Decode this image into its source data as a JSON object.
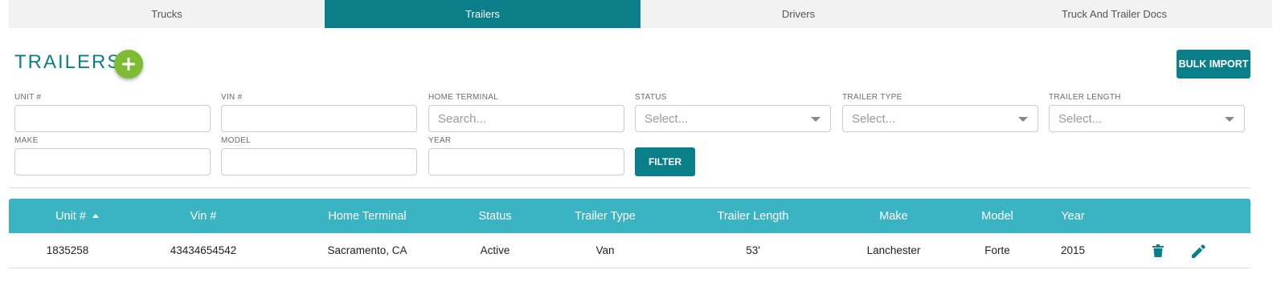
{
  "tabs": [
    {
      "label": "Trucks",
      "active": false
    },
    {
      "label": "Trailers",
      "active": true
    },
    {
      "label": "Drivers",
      "active": false
    },
    {
      "label": "Truck And Trailer Docs",
      "active": false
    }
  ],
  "header": {
    "title": "TRAILERS",
    "add_icon": "plus-icon",
    "bulk_import_label": "BULK IMPORT"
  },
  "filters": {
    "unit": {
      "label": "UNIT #",
      "value": "",
      "placeholder": ""
    },
    "vin": {
      "label": "VIN #",
      "value": "",
      "placeholder": ""
    },
    "home_terminal": {
      "label": "HOME TERMINAL",
      "value": "",
      "placeholder": "Search..."
    },
    "status": {
      "label": "STATUS",
      "selected": "Select..."
    },
    "trailer_type": {
      "label": "TRAILER TYPE",
      "selected": "Select..."
    },
    "trailer_length": {
      "label": "TRAILER LENGTH",
      "selected": "Select..."
    },
    "make": {
      "label": "MAKE",
      "value": "",
      "placeholder": ""
    },
    "model": {
      "label": "MODEL",
      "value": "",
      "placeholder": ""
    },
    "year": {
      "label": "YEAR",
      "value": "",
      "placeholder": ""
    },
    "filter_button_label": "FILTER"
  },
  "table": {
    "columns": [
      "Unit #",
      "Vin #",
      "Home Terminal",
      "Status",
      "Trailer Type",
      "Trailer Length",
      "Make",
      "Model",
      "Year"
    ],
    "sorted_column": "Unit #",
    "sort_direction": "asc",
    "rows": [
      {
        "unit": "1835258",
        "vin": "43434654542",
        "home_terminal": "Sacramento, CA",
        "status": "Active",
        "trailer_type": "Van",
        "trailer_length": "53'",
        "make": "Lanchester",
        "model": "Forte",
        "year": "2015",
        "actions": [
          "trash-icon",
          "pencil-icon"
        ]
      }
    ]
  },
  "colors": {
    "primary": "#0a7f8a",
    "table_header": "#3ab3c3",
    "add_button": "#7dbb33"
  }
}
